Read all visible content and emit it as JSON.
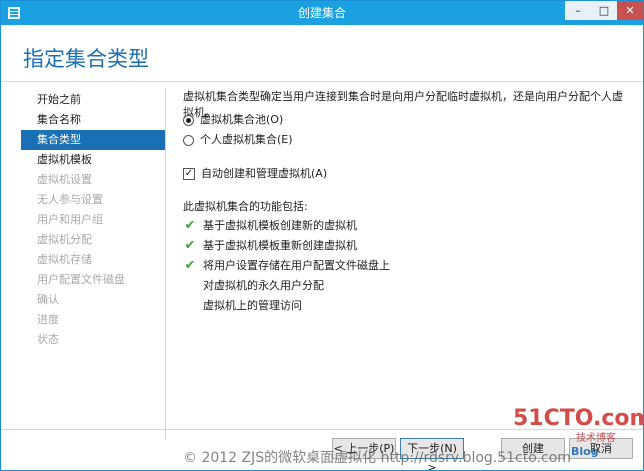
{
  "window": {
    "title": "创建集合",
    "controls": {
      "minimize": "–",
      "maximize": "□",
      "close": "✕"
    },
    "accent_color": "#1ba1e2"
  },
  "page_title": "指定集合类型",
  "nav": {
    "items": [
      {
        "label": "开始之前",
        "state": "enabled"
      },
      {
        "label": "集合名称",
        "state": "enabled"
      },
      {
        "label": "集合类型",
        "state": "active"
      },
      {
        "label": "虚拟机模板",
        "state": "enabled"
      },
      {
        "label": "虚拟机设置",
        "state": "disabled"
      },
      {
        "label": "无人参与设置",
        "state": "disabled"
      },
      {
        "label": "用户和用户组",
        "state": "disabled"
      },
      {
        "label": "虚拟机分配",
        "state": "disabled"
      },
      {
        "label": "虚拟机存储",
        "state": "disabled"
      },
      {
        "label": "用户配置文件磁盘",
        "state": "disabled"
      },
      {
        "label": "确认",
        "state": "disabled"
      },
      {
        "label": "进度",
        "state": "disabled"
      },
      {
        "label": "状态",
        "state": "disabled"
      }
    ],
    "active_color": "#1b6fb4"
  },
  "content": {
    "description": "虚拟机集合类型确定当用户连接到集合时是向用户分配临时虚拟机，还是向用户分配个人虚拟机。",
    "options": [
      {
        "label": "虚拟机集合池(O)",
        "selected": true
      },
      {
        "label": "个人虚拟机集合(E)",
        "selected": false
      }
    ],
    "auto_manage": {
      "label": "自动创建和管理虚拟机(A)",
      "checked": true
    },
    "features_heading": "此虚拟机集合的功能包括:",
    "features": [
      {
        "label": "基于虚拟机模板创建新的虚拟机",
        "checked": true
      },
      {
        "label": "基于虚拟机模板重新创建虚拟机",
        "checked": true
      },
      {
        "label": "将用户设置存储在用户配置文件磁盘上",
        "checked": true
      },
      {
        "label": "对虚拟机的永久用户分配",
        "checked": false
      },
      {
        "label": "虚拟机上的管理访问",
        "checked": false
      }
    ]
  },
  "footer": {
    "prev": "< 上一步(P)",
    "next": "下一步(N) >",
    "create": "创建",
    "cancel": "取消"
  },
  "watermarks": {
    "copyright": "© 2012 ZJS的微软桌面虚拟化 http://rdsrv.blog.51cto.com",
    "logo": "51CTO.com",
    "logo_sub": "技术博客",
    "site": "Blog"
  }
}
